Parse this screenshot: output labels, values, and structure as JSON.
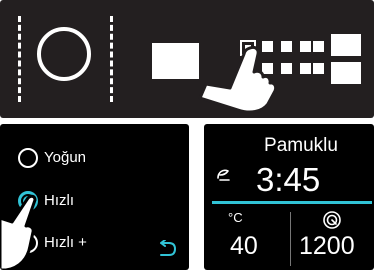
{
  "colors": {
    "panel_dark": "#231f20",
    "panel_black": "#000000",
    "accent_cyan": "#31c3d6",
    "foreground": "#ffffff"
  },
  "top_panel": {
    "icons": [
      "dial-icon",
      "hand-pointer-icon",
      "select-square-icon"
    ]
  },
  "program_options": {
    "items": [
      {
        "label": "Yoğun",
        "selected": false
      },
      {
        "label": "Hızlı",
        "selected": true
      },
      {
        "label": "Hızlı +",
        "selected": false
      }
    ],
    "back_icon": "back-arrow-icon"
  },
  "status_display": {
    "program_name": "Pamuklu",
    "duration": "3:45",
    "temperature_unit": "°C",
    "temperature_value": "40",
    "spin_value": "1200",
    "icons": [
      "spin-speed-icon",
      "spin-indicator-icon"
    ]
  }
}
